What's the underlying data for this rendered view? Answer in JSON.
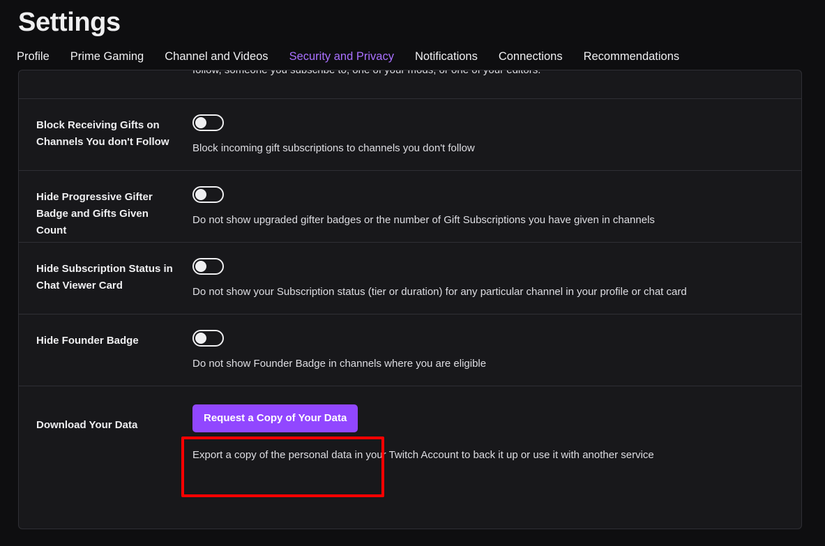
{
  "header": {
    "title": "Settings",
    "tabs": [
      {
        "label": "Profile",
        "active": false
      },
      {
        "label": "Prime Gaming",
        "active": false
      },
      {
        "label": "Channel and Videos",
        "active": false
      },
      {
        "label": "Security and Privacy",
        "active": true
      },
      {
        "label": "Notifications",
        "active": false
      },
      {
        "label": "Connections",
        "active": false
      },
      {
        "label": "Recommendations",
        "active": false
      }
    ],
    "active_tab_color": "#a970ff"
  },
  "panel": {
    "clipped_row": {
      "text": "follow, someone you subscribe to, one of your mods, or one of your editors."
    },
    "rows": [
      {
        "label": "Block Receiving Gifts on Channels You don't Follow",
        "description": "Block incoming gift subscriptions to channels you don't follow",
        "toggle": "off"
      },
      {
        "label": "Hide Progressive Gifter Badge and Gifts Given Count",
        "description": "Do not show upgraded gifter badges or the number of Gift Subscriptions you have given in channels",
        "toggle": "off"
      },
      {
        "label": "Hide Subscription Status in Chat Viewer Card",
        "description": "Do not show your Subscription status (tier or duration) for any particular channel in your profile or chat card",
        "toggle": "off"
      },
      {
        "label": "Hide Founder Badge",
        "description": "Do not show Founder Badge in channels where you are eligible",
        "toggle": "off"
      }
    ],
    "download_row": {
      "label": "Download Your Data",
      "button_label": "Request a Copy of Your Data",
      "description": "Export a copy of the personal data in your Twitch Account to back it up or use it with another service",
      "button_color": "#9147ff"
    }
  },
  "annotation": {
    "color": "#ff0000",
    "target": "request-a-copy-of-your-data-button"
  }
}
